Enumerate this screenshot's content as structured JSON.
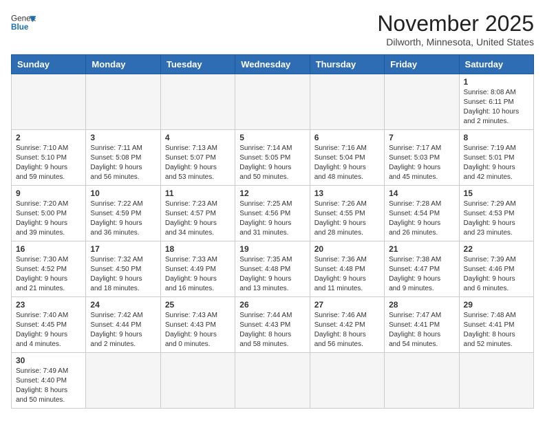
{
  "header": {
    "logo_general": "General",
    "logo_blue": "Blue",
    "month_title": "November 2025",
    "location": "Dilworth, Minnesota, United States"
  },
  "weekdays": [
    "Sunday",
    "Monday",
    "Tuesday",
    "Wednesday",
    "Thursday",
    "Friday",
    "Saturday"
  ],
  "weeks": [
    [
      {
        "date": "",
        "info": ""
      },
      {
        "date": "",
        "info": ""
      },
      {
        "date": "",
        "info": ""
      },
      {
        "date": "",
        "info": ""
      },
      {
        "date": "",
        "info": ""
      },
      {
        "date": "",
        "info": ""
      },
      {
        "date": "1",
        "info": "Sunrise: 8:08 AM\nSunset: 6:11 PM\nDaylight: 10 hours\nand 2 minutes."
      }
    ],
    [
      {
        "date": "2",
        "info": "Sunrise: 7:10 AM\nSunset: 5:10 PM\nDaylight: 9 hours\nand 59 minutes."
      },
      {
        "date": "3",
        "info": "Sunrise: 7:11 AM\nSunset: 5:08 PM\nDaylight: 9 hours\nand 56 minutes."
      },
      {
        "date": "4",
        "info": "Sunrise: 7:13 AM\nSunset: 5:07 PM\nDaylight: 9 hours\nand 53 minutes."
      },
      {
        "date": "5",
        "info": "Sunrise: 7:14 AM\nSunset: 5:05 PM\nDaylight: 9 hours\nand 50 minutes."
      },
      {
        "date": "6",
        "info": "Sunrise: 7:16 AM\nSunset: 5:04 PM\nDaylight: 9 hours\nand 48 minutes."
      },
      {
        "date": "7",
        "info": "Sunrise: 7:17 AM\nSunset: 5:03 PM\nDaylight: 9 hours\nand 45 minutes."
      },
      {
        "date": "8",
        "info": "Sunrise: 7:19 AM\nSunset: 5:01 PM\nDaylight: 9 hours\nand 42 minutes."
      }
    ],
    [
      {
        "date": "9",
        "info": "Sunrise: 7:20 AM\nSunset: 5:00 PM\nDaylight: 9 hours\nand 39 minutes."
      },
      {
        "date": "10",
        "info": "Sunrise: 7:22 AM\nSunset: 4:59 PM\nDaylight: 9 hours\nand 36 minutes."
      },
      {
        "date": "11",
        "info": "Sunrise: 7:23 AM\nSunset: 4:57 PM\nDaylight: 9 hours\nand 34 minutes."
      },
      {
        "date": "12",
        "info": "Sunrise: 7:25 AM\nSunset: 4:56 PM\nDaylight: 9 hours\nand 31 minutes."
      },
      {
        "date": "13",
        "info": "Sunrise: 7:26 AM\nSunset: 4:55 PM\nDaylight: 9 hours\nand 28 minutes."
      },
      {
        "date": "14",
        "info": "Sunrise: 7:28 AM\nSunset: 4:54 PM\nDaylight: 9 hours\nand 26 minutes."
      },
      {
        "date": "15",
        "info": "Sunrise: 7:29 AM\nSunset: 4:53 PM\nDaylight: 9 hours\nand 23 minutes."
      }
    ],
    [
      {
        "date": "16",
        "info": "Sunrise: 7:30 AM\nSunset: 4:52 PM\nDaylight: 9 hours\nand 21 minutes."
      },
      {
        "date": "17",
        "info": "Sunrise: 7:32 AM\nSunset: 4:50 PM\nDaylight: 9 hours\nand 18 minutes."
      },
      {
        "date": "18",
        "info": "Sunrise: 7:33 AM\nSunset: 4:49 PM\nDaylight: 9 hours\nand 16 minutes."
      },
      {
        "date": "19",
        "info": "Sunrise: 7:35 AM\nSunset: 4:48 PM\nDaylight: 9 hours\nand 13 minutes."
      },
      {
        "date": "20",
        "info": "Sunrise: 7:36 AM\nSunset: 4:48 PM\nDaylight: 9 hours\nand 11 minutes."
      },
      {
        "date": "21",
        "info": "Sunrise: 7:38 AM\nSunset: 4:47 PM\nDaylight: 9 hours\nand 9 minutes."
      },
      {
        "date": "22",
        "info": "Sunrise: 7:39 AM\nSunset: 4:46 PM\nDaylight: 9 hours\nand 6 minutes."
      }
    ],
    [
      {
        "date": "23",
        "info": "Sunrise: 7:40 AM\nSunset: 4:45 PM\nDaylight: 9 hours\nand 4 minutes."
      },
      {
        "date": "24",
        "info": "Sunrise: 7:42 AM\nSunset: 4:44 PM\nDaylight: 9 hours\nand 2 minutes."
      },
      {
        "date": "25",
        "info": "Sunrise: 7:43 AM\nSunset: 4:43 PM\nDaylight: 9 hours\nand 0 minutes."
      },
      {
        "date": "26",
        "info": "Sunrise: 7:44 AM\nSunset: 4:43 PM\nDaylight: 8 hours\nand 58 minutes."
      },
      {
        "date": "27",
        "info": "Sunrise: 7:46 AM\nSunset: 4:42 PM\nDaylight: 8 hours\nand 56 minutes."
      },
      {
        "date": "28",
        "info": "Sunrise: 7:47 AM\nSunset: 4:41 PM\nDaylight: 8 hours\nand 54 minutes."
      },
      {
        "date": "29",
        "info": "Sunrise: 7:48 AM\nSunset: 4:41 PM\nDaylight: 8 hours\nand 52 minutes."
      }
    ],
    [
      {
        "date": "30",
        "info": "Sunrise: 7:49 AM\nSunset: 4:40 PM\nDaylight: 8 hours\nand 50 minutes."
      },
      {
        "date": "",
        "info": ""
      },
      {
        "date": "",
        "info": ""
      },
      {
        "date": "",
        "info": ""
      },
      {
        "date": "",
        "info": ""
      },
      {
        "date": "",
        "info": ""
      },
      {
        "date": "",
        "info": ""
      }
    ]
  ]
}
